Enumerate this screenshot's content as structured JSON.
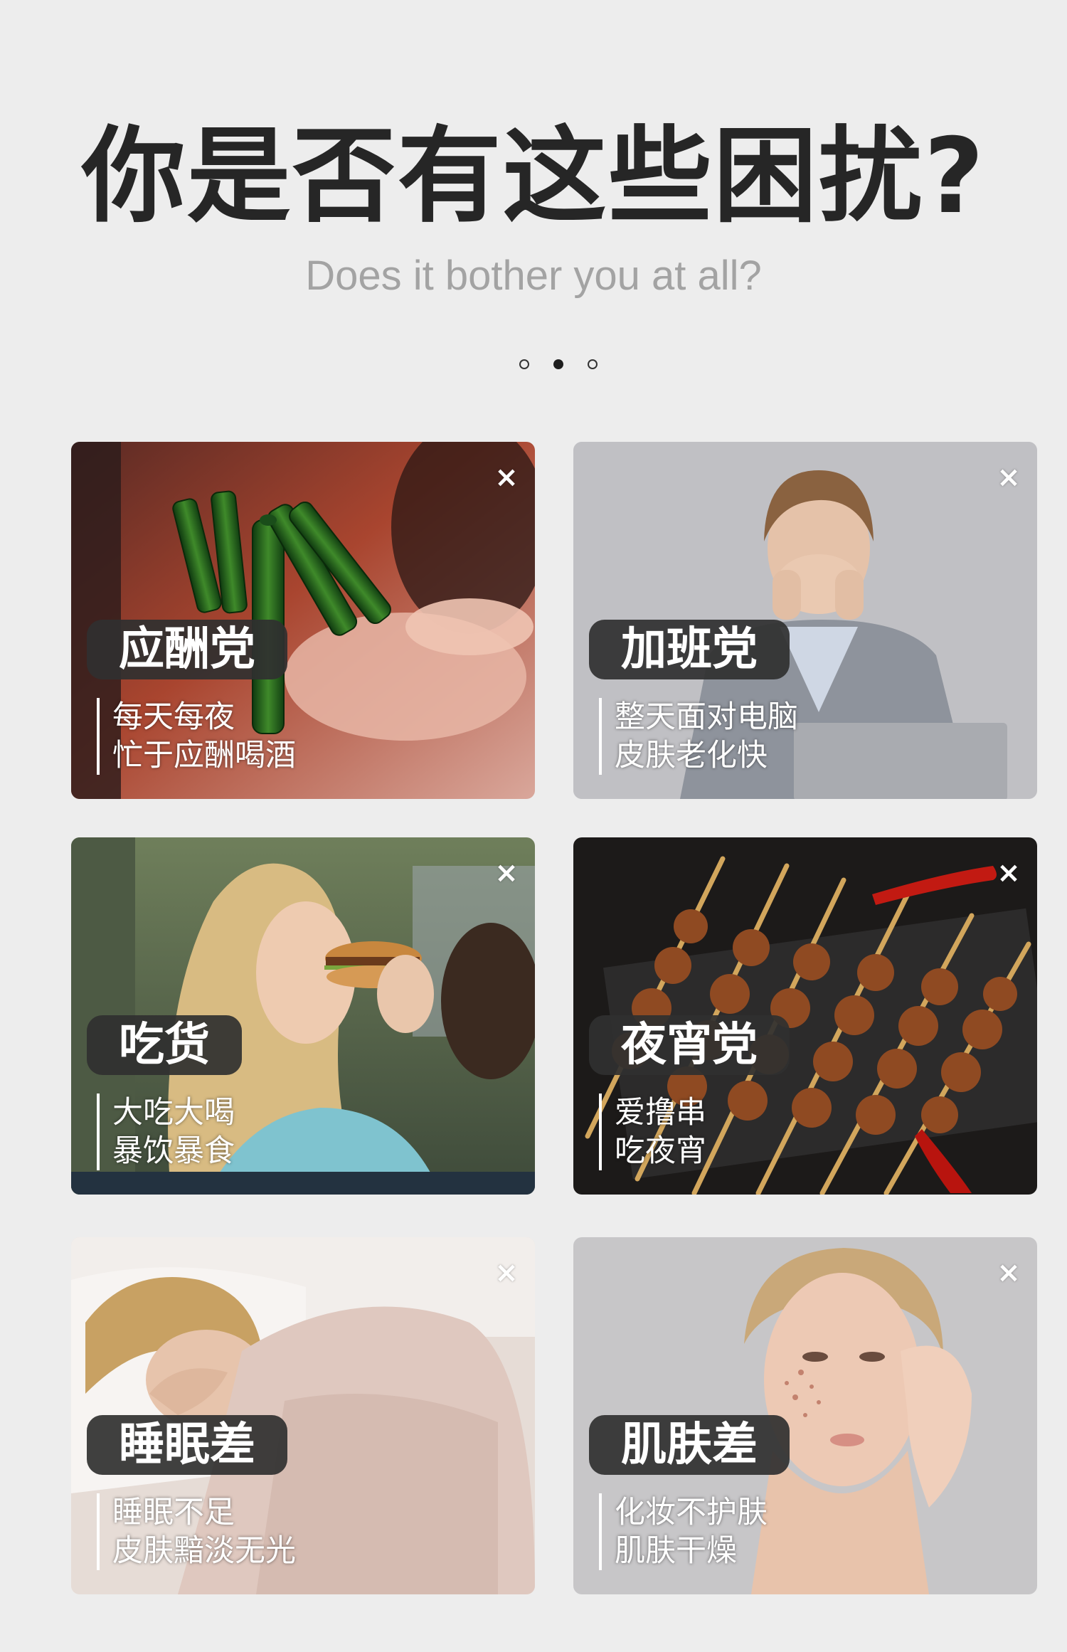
{
  "header": {
    "title": "你是否有这些困扰?",
    "subtitle": "Does it bother you at all?",
    "pager": {
      "count": 3,
      "active_index": 2
    }
  },
  "cards": [
    {
      "tag": "应酬党",
      "lines": [
        "每天每夜",
        "忙于应酬喝酒"
      ],
      "close_icon": "×",
      "scene": "beer-bottles"
    },
    {
      "tag": "加班党",
      "lines": [
        "整天面对电脑",
        "皮肤老化快"
      ],
      "close_icon": "×",
      "scene": "tired-office-worker"
    },
    {
      "tag": "吃货",
      "lines": [
        "大吃大喝",
        "暴饮暴食"
      ],
      "close_icon": "×",
      "scene": "woman-eating-burger"
    },
    {
      "tag": "夜宵党",
      "lines": [
        "爱撸串",
        "吃夜宵"
      ],
      "close_icon": "×",
      "scene": "grilled-skewers"
    },
    {
      "tag": "睡眠差",
      "lines": [
        "睡眠不足",
        "皮肤黯淡无光"
      ],
      "close_icon": "×",
      "scene": "sleeping-woman"
    },
    {
      "tag": "肌肤差",
      "lines": [
        "化妆不护肤",
        "肌肤干燥"
      ],
      "close_icon": "×",
      "scene": "woman-with-blemishes"
    }
  ]
}
